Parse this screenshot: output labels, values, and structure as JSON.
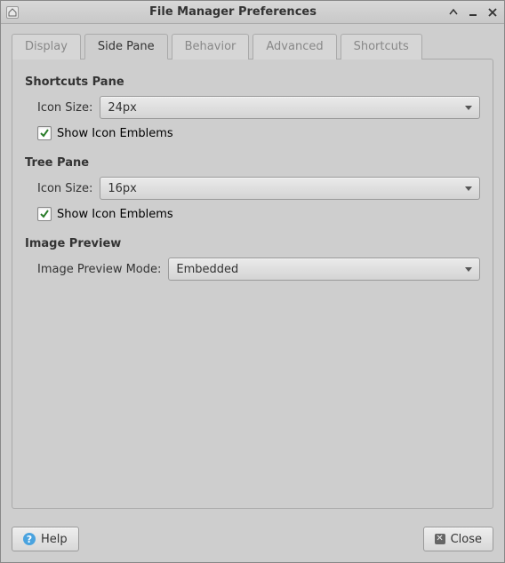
{
  "window": {
    "title": "File Manager Preferences"
  },
  "tabs": {
    "display": "Display",
    "side_pane": "Side Pane",
    "behavior": "Behavior",
    "advanced": "Advanced",
    "shortcuts": "Shortcuts"
  },
  "sections": {
    "shortcuts_pane": {
      "title": "Shortcuts Pane",
      "icon_size_label": "Icon Size:",
      "icon_size_value": "24px",
      "show_emblems_label": "Show Icon Emblems",
      "show_emblems_checked": true
    },
    "tree_pane": {
      "title": "Tree Pane",
      "icon_size_label": "Icon Size:",
      "icon_size_value": "16px",
      "show_emblems_label": "Show Icon Emblems",
      "show_emblems_checked": true
    },
    "image_preview": {
      "title": "Image Preview",
      "mode_label": "Image Preview Mode:",
      "mode_value": "Embedded"
    }
  },
  "footer": {
    "help_label": "Help",
    "close_label": "Close"
  }
}
